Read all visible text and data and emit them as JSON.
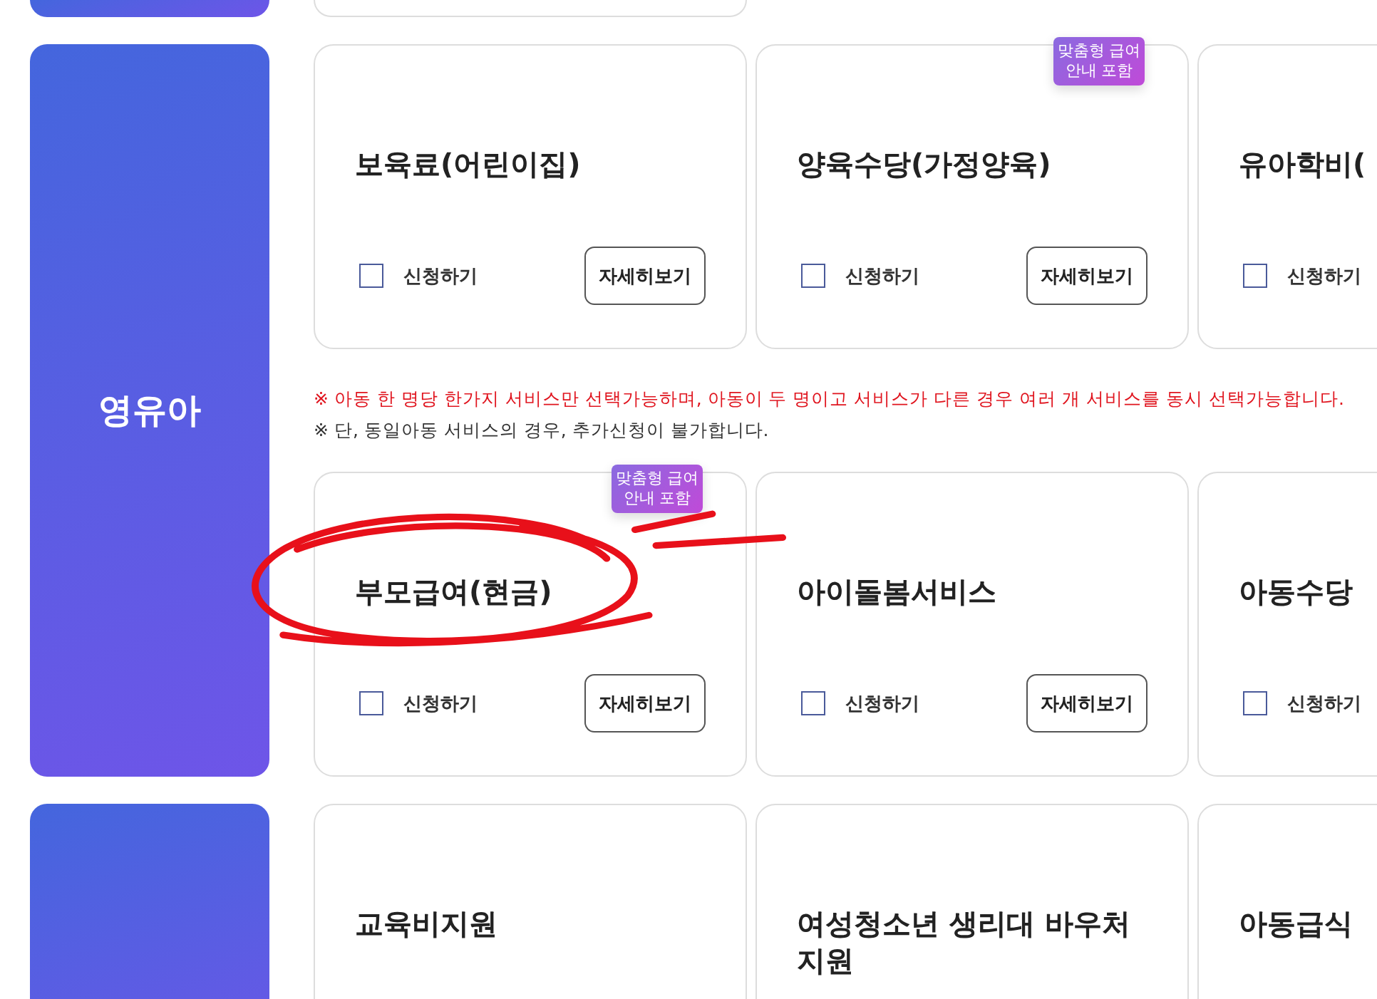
{
  "sections": [
    {
      "kind": "partial"
    },
    {
      "kind": "full",
      "label": "영유아",
      "rows": [
        {
          "kind": "cards",
          "cards": [
            {
              "title": "보육료(어린이집)",
              "checkbox": {
                "label": "신청하기",
                "checked": false
              },
              "button": "자세히보기"
            },
            {
              "title": "양육수당(가정양육)",
              "badge": "맞춤형 급여안내 포함",
              "checkbox": {
                "label": "신청하기",
                "checked": false
              },
              "button": "자세히보기"
            },
            {
              "title": "유아학비(",
              "checkbox": {
                "label": "신청하기",
                "checked": false
              }
            }
          ]
        },
        {
          "kind": "notes",
          "notes": [
            {
              "kind": "warning",
              "text": "※ 아동 한 명당 한가지 서비스만 선택가능하며, 아동이 두 명이고 서비스가 다른 경우 여러 개 서비스를 동시 선택가능합니다."
            },
            {
              "kind": "info",
              "text": "※ 단, 동일아동 서비스의 경우, 추가신청이 불가합니다."
            }
          ]
        },
        {
          "kind": "cards",
          "cards": [
            {
              "title": "부모급여(현금)",
              "badge": "맞춤형 급여안내 포함",
              "circled": true,
              "checkbox": {
                "label": "신청하기",
                "checked": false
              },
              "button": "자세히보기"
            },
            {
              "title": "아이돌봄서비스",
              "checkbox": {
                "label": "신청하기",
                "checked": false
              },
              "button": "자세히보기"
            },
            {
              "title": "아동수당",
              "checkbox": {
                "label": "신청하기",
                "checked": false
              }
            }
          ]
        }
      ]
    },
    {
      "kind": "full",
      "rows": [
        {
          "kind": "cards",
          "cards": [
            {
              "title": "교육비지원"
            },
            {
              "title": "여성청소년 생리대 바우처지원"
            },
            {
              "title": "아동급식"
            }
          ]
        }
      ]
    }
  ]
}
